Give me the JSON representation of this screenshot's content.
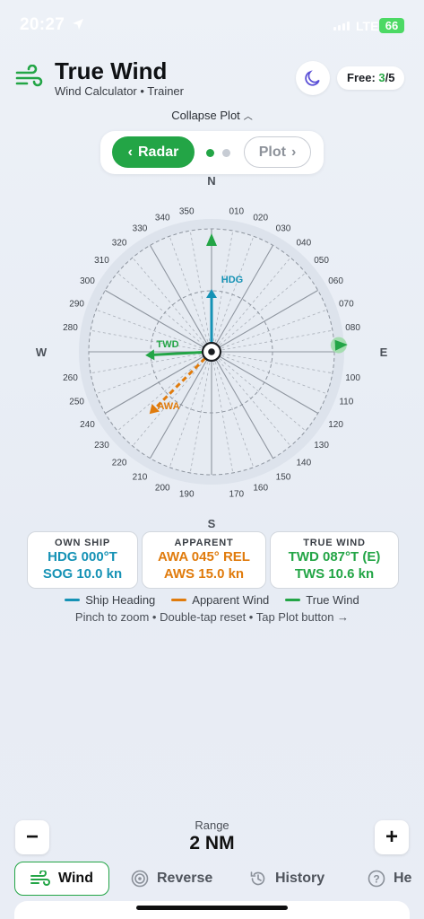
{
  "status_bar": {
    "time": "20:27",
    "network": "LTE",
    "battery": "66"
  },
  "header": {
    "title": "True Wind",
    "subtitle": "Wind Calculator • Trainer",
    "free_label": "Free: ",
    "free_used": "3",
    "free_total": "/5"
  },
  "collapse_label": "Collapse Plot",
  "mode_toggle": {
    "radar_label": "Radar",
    "plot_label": "Plot"
  },
  "radar": {
    "cardinals": {
      "n": "N",
      "e": "E",
      "s": "S",
      "w": "W"
    },
    "bearing_labels": [
      "010",
      "020",
      "030",
      "040",
      "050",
      "060",
      "070",
      "080",
      "100",
      "110",
      "120",
      "130",
      "140",
      "150",
      "160",
      "170",
      "190",
      "200",
      "210",
      "220",
      "230",
      "240",
      "250",
      "260",
      "280",
      "290",
      "300",
      "310",
      "320",
      "330",
      "340",
      "350"
    ],
    "hdg_label": "HDG",
    "twd_label": "TWD",
    "awa_label": "AWA",
    "heading_deg": 0,
    "apparent_wind_dir_deg": 225,
    "true_wind_dir_deg": 267,
    "target_bearing_deg": 87
  },
  "cards": {
    "own_ship": {
      "label": "OWN SHIP",
      "line1": "HDG 000°T",
      "line2": "SOG 10.0 kn"
    },
    "apparent": {
      "label": "APPARENT",
      "line1": "AWA 045° REL",
      "line2": "AWS 15.0 kn"
    },
    "true_wind": {
      "label": "TRUE WIND",
      "line1": "TWD 087°T (E)",
      "line2": "TWS 10.6 kn"
    }
  },
  "legend": {
    "ship_heading": "Ship Heading",
    "apparent_wind": "Apparent Wind",
    "true_wind": "True Wind"
  },
  "hint": "Pinch to zoom • Double-tap reset • Tap Plot button →",
  "range": {
    "label": "Range",
    "value": "2 NM",
    "minus": "−",
    "plus": "+"
  },
  "tabs": {
    "wind": "Wind",
    "reverse": "Reverse",
    "history": "History",
    "help": "He"
  },
  "colors": {
    "accent_green": "#23a546",
    "heading_blue": "#1592b5",
    "apparent_orange": "#e07b0c"
  }
}
